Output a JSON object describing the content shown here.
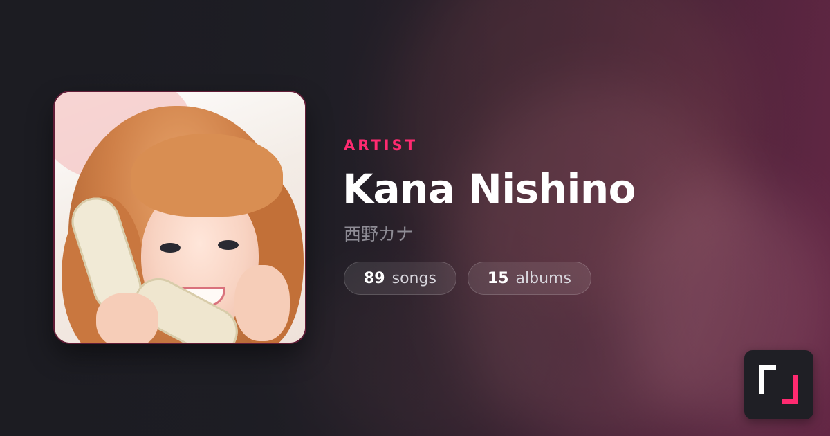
{
  "artist": {
    "label": "ARTIST",
    "name": "Kana Nishino",
    "native_name": "西野カナ",
    "stats": [
      {
        "count": "89",
        "unit": "songs"
      },
      {
        "count": "15",
        "unit": "albums"
      }
    ]
  },
  "artwork": {
    "description_icon": "artist-photo"
  },
  "brand": {
    "logo_icon": "bracket-logo-icon",
    "accent": "#ff2a70",
    "badge_bg": "#1f1f25"
  },
  "colors": {
    "background": "#1c1c22",
    "title": "#ffffff",
    "subtitle": "#8e8c95"
  }
}
